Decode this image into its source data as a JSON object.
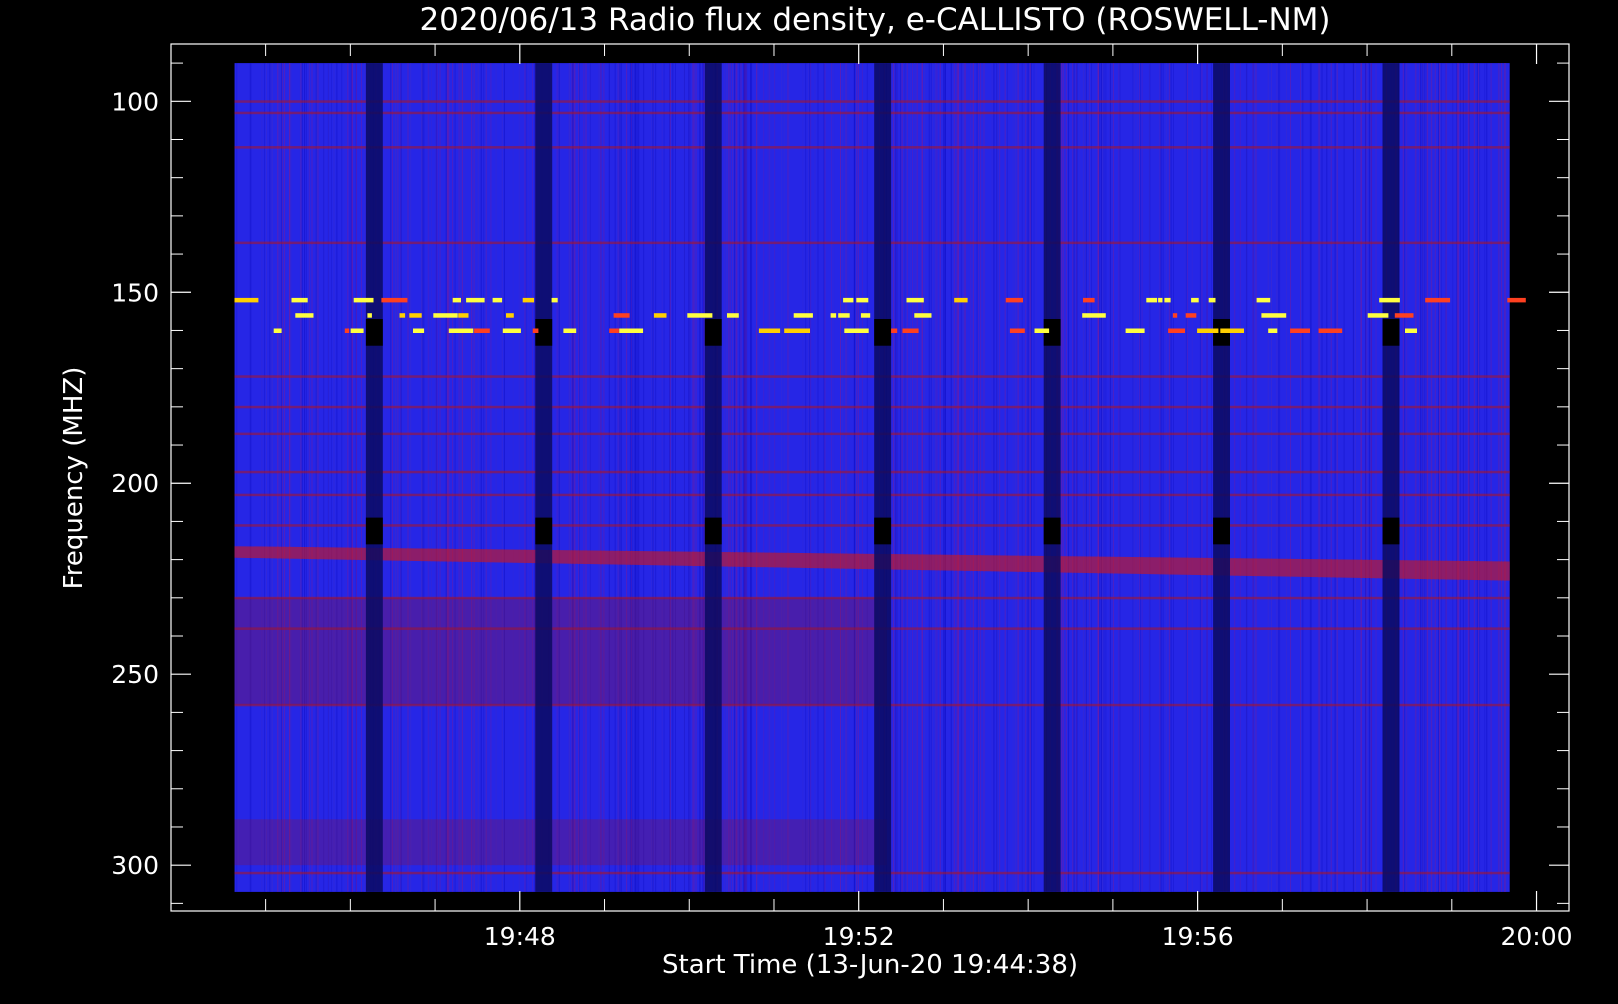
{
  "chart_data": {
    "type": "heatmap",
    "title": "2020/06/13  Radio flux density, e-CALLISTO (ROSWELL-NM)",
    "xlabel": "Start Time (13-Jun-20 19:44:38)",
    "ylabel": "Frequency (MHZ)",
    "x_tick_labels": [
      "19:48",
      "19:52",
      "19:56",
      "20:00"
    ],
    "x_tick_values_min": [
      3.3667,
      7.3667,
      11.3667,
      15.3667
    ],
    "y_tick_labels": [
      "100",
      "150",
      "200",
      "250",
      "300"
    ],
    "y_tick_values": [
      100,
      150,
      200,
      250,
      300
    ],
    "xlim_min": [
      -0.75,
      15.75
    ],
    "ylim": [
      85,
      312
    ],
    "data_xlim_min": [
      0,
      15.05
    ],
    "data_ylim": [
      90,
      307
    ],
    "y_inverted": true,
    "colormap": {
      "low": "#000000",
      "mid_low": "#1a1aff",
      "mid_high": "#d00000",
      "high": "#ffff40"
    },
    "background_color": "#2626e6",
    "features": {
      "dark_gap_columns_min": [
        1.55,
        3.55,
        5.55,
        7.55,
        9.55,
        11.55,
        13.55
      ],
      "dark_gap_width_min": 0.2,
      "strong_interference_bands_mhz": [
        152,
        156,
        160
      ],
      "red_interference_lines_mhz": [
        100,
        103,
        112,
        137,
        172,
        180,
        187,
        197,
        203,
        211,
        230,
        238,
        258,
        302
      ],
      "drifting_red_band": {
        "start_min": 0,
        "start_mhz": 218,
        "end_min": 15.05,
        "end_mhz": 223
      }
    }
  }
}
